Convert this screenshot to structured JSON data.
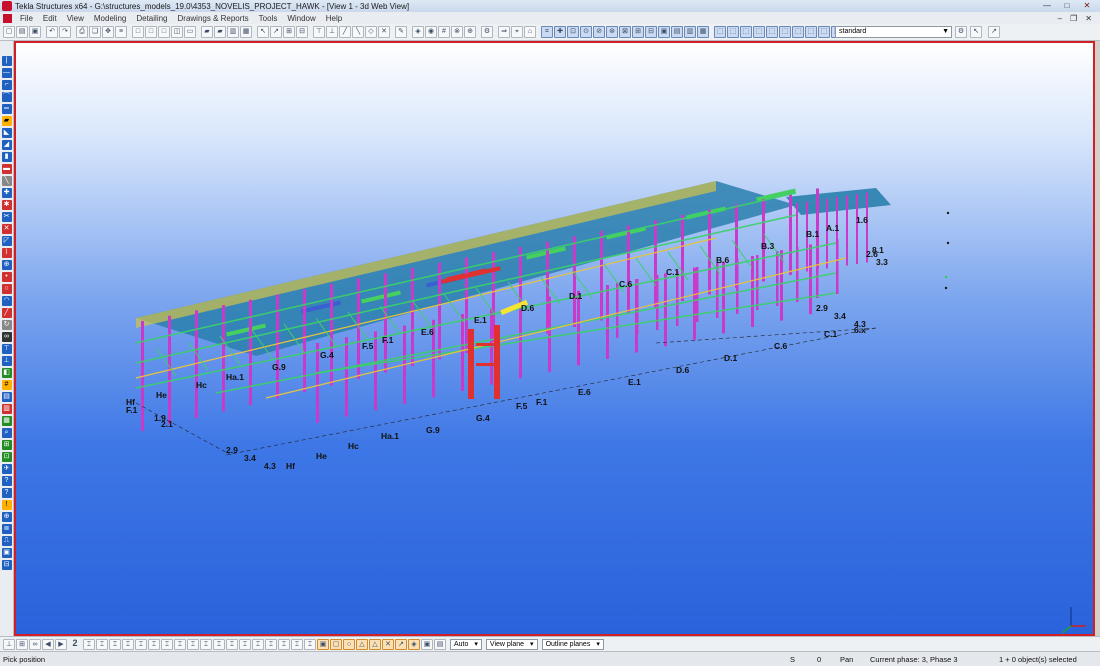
{
  "window": {
    "title": "Tekla Structures x64 - G:\\structures_models_19.0\\4353_NOVELIS_PROJECT_HAWK - [View 1 - 3d Web View]",
    "buttons": {
      "minimize": "—",
      "maximize": "□",
      "close": "✕"
    },
    "mdi_buttons": {
      "minimize": "–",
      "restore": "❐",
      "close": "✕"
    }
  },
  "menubar": {
    "items": [
      "File",
      "Edit",
      "View",
      "Modeling",
      "Detailing",
      "Drawings & Reports",
      "Tools",
      "Window",
      "Help"
    ]
  },
  "toolbar": {
    "view_select": "standard"
  },
  "bottom_toolbar": {
    "number_label": "2",
    "snap_mode": "Auto",
    "plane_mode": "View plane",
    "outline_mode": "Outline planes"
  },
  "status": {
    "prompt": "Pick position",
    "snap_flag": "S",
    "number": "0",
    "mode": "Pan",
    "phase": "Current phase: 3, Phase 3",
    "selection": "1 + 0 object(s) selected"
  },
  "model": {
    "background_top": "#ffffff",
    "background_bottom": "#2a62db",
    "column_color": "#c93acb",
    "brace_color": "#3cd06a",
    "roof_color": "#2a7fae",
    "highlight_color": "#e03030",
    "grid_labels_front": [
      "Hf",
      "F.1",
      "1.9",
      "2.1",
      "2.9",
      "3.4",
      "4.3",
      "Hf",
      "He",
      "Hc",
      "Ha.1",
      "G.9",
      "G.4",
      "F.5",
      "F.1",
      "E.6",
      "E.1",
      "D.6",
      "D.1",
      "C.6",
      "C.1",
      "2.9",
      "3.4",
      "4.3",
      "6.x"
    ],
    "grid_labels_top": [
      "He",
      "Hc",
      "Ha.1",
      "G.9",
      "G.4",
      "F.5",
      "F.1",
      "E.6",
      "E.1",
      "D.6",
      "D.1",
      "C.6",
      "C.1",
      "B.6",
      "B.3",
      "B.1",
      "A.1",
      "1.6",
      "2.6",
      "3.3",
      "8.1"
    ]
  }
}
